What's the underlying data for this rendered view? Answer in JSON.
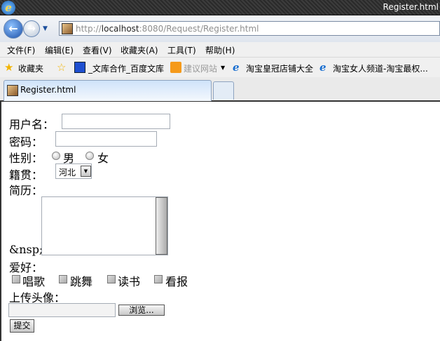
{
  "window": {
    "title": "Register.html"
  },
  "address": {
    "url_prefix": "http://",
    "url_host": "localhost",
    "url_rest": ":8080/Request/Register.html"
  },
  "menu": [
    "文件(F)",
    "编辑(E)",
    "查看(V)",
    "收藏夹(A)",
    "工具(T)",
    "帮助(H)"
  ],
  "favorites": {
    "label": "收藏夹",
    "items": [
      "_文库合作_百度文库",
      "建议网站",
      "淘宝皇冠店铺大全",
      "淘宝女人频道-淘宝最权..."
    ]
  },
  "tab": {
    "label": "Register.html"
  },
  "form": {
    "username_label": "用户名：",
    "username_value": "",
    "password_label": "密码：",
    "password_value": "",
    "gender_label": "性别：",
    "gender_options": [
      "男",
      "女"
    ],
    "hometown_label": "籍贯：",
    "hometown_value": "河北",
    "resume_label": "简历：",
    "resume_prefix": "&nsp;",
    "resume_value": "",
    "hobby_label": "爱好：",
    "hobbies": [
      "唱歌",
      "跳舞",
      "读书",
      "看报"
    ],
    "avatar_label": "上传头像：",
    "browse_label": "浏览...",
    "submit_label": "提交"
  }
}
